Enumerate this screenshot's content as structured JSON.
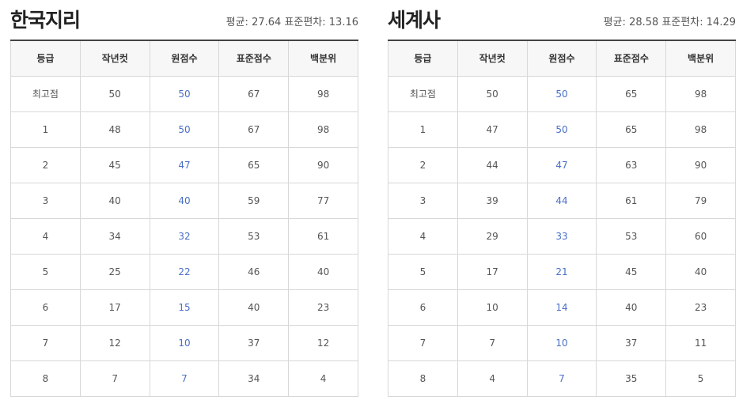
{
  "panels": [
    {
      "title": "한국지리",
      "stats": "평균: 27.64 표준편차: 13.16",
      "headers": [
        "등급",
        "작년컷",
        "원점수",
        "표준점수",
        "백분위"
      ],
      "rows": [
        [
          "최고점",
          "50",
          "50",
          "67",
          "98"
        ],
        [
          "1",
          "48",
          "50",
          "67",
          "98"
        ],
        [
          "2",
          "45",
          "47",
          "65",
          "90"
        ],
        [
          "3",
          "40",
          "40",
          "59",
          "77"
        ],
        [
          "4",
          "34",
          "32",
          "53",
          "61"
        ],
        [
          "5",
          "25",
          "22",
          "46",
          "40"
        ],
        [
          "6",
          "17",
          "15",
          "40",
          "23"
        ],
        [
          "7",
          "12",
          "10",
          "37",
          "12"
        ],
        [
          "8",
          "7",
          "7",
          "34",
          "4"
        ]
      ]
    },
    {
      "title": "세계사",
      "stats": "평균: 28.58 표준편차: 14.29",
      "headers": [
        "등급",
        "작년컷",
        "원점수",
        "표준점수",
        "백분위"
      ],
      "rows": [
        [
          "최고점",
          "50",
          "50",
          "65",
          "98"
        ],
        [
          "1",
          "47",
          "50",
          "65",
          "98"
        ],
        [
          "2",
          "44",
          "47",
          "63",
          "90"
        ],
        [
          "3",
          "39",
          "44",
          "61",
          "79"
        ],
        [
          "4",
          "29",
          "33",
          "53",
          "60"
        ],
        [
          "5",
          "17",
          "21",
          "45",
          "40"
        ],
        [
          "6",
          "10",
          "14",
          "40",
          "23"
        ],
        [
          "7",
          "7",
          "10",
          "37",
          "11"
        ],
        [
          "8",
          "4",
          "7",
          "35",
          "5"
        ]
      ]
    }
  ],
  "colors": {
    "raw_score": "#4a6fc7",
    "header_bg": "#f7f7f7",
    "border": "#d8d8d8"
  }
}
